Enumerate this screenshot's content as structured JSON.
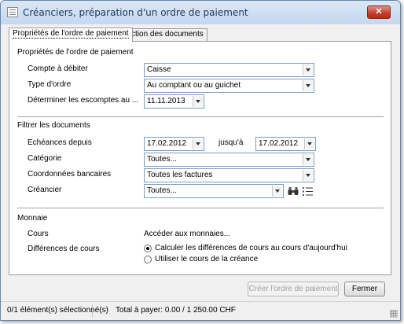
{
  "window": {
    "title": "Créanciers, préparation d'un ordre de paiement",
    "close_label": "✕"
  },
  "tabs": [
    {
      "label": "Propriétés de l'ordre de paiement",
      "active": true
    },
    {
      "label": "Sélection des documents",
      "active": false
    }
  ],
  "payment_properties": {
    "heading": "Propriétés de l'ordre de paiement",
    "account_label": "Compte à débiter",
    "account_value": "Caisse",
    "order_type_label": "Type d'ordre",
    "order_type_value": "Au comptant ou au guichet",
    "discount_label": "Déterminer les escomptes au ...",
    "discount_date": "11.11.2013"
  },
  "filter": {
    "heading": "Filtrer les documents",
    "due_from_label": "Echéances depuis",
    "due_from_value": "17.02.2012",
    "until_label": "jusqu'à",
    "until_value": "17.02.2012",
    "category_label": "Catégorie",
    "category_value": "Toutes...",
    "bank_label": "Coordonnées bancaires",
    "bank_value": "Toutes les factures",
    "creditor_label": "Créancier",
    "creditor_value": "Toutes..."
  },
  "currency": {
    "heading": "Monnaie",
    "rates_label": "Cours",
    "rates_link": "Accéder aux monnaies...",
    "diff_label": "Différences de cours",
    "option_today": "Calculer les différences de cours au cours d'aujourd'hui",
    "option_claim": "Utiliser le cours de la créance",
    "selected_option": "today"
  },
  "buttons": {
    "create": "Créer l'ordre de paiement",
    "close": "Fermer"
  },
  "status": {
    "selection": "0/1 élément(s) sélectionné(s)",
    "total": "Total à payer: 0.00 / 1 250.00 CHF"
  },
  "icons": {
    "app": "document-icon",
    "search": "binoculars-icon",
    "list": "list-icon"
  },
  "colors": {
    "title_text": "#1e3957",
    "close_button": "#c23b28",
    "field_border": "#7b9ebd"
  }
}
